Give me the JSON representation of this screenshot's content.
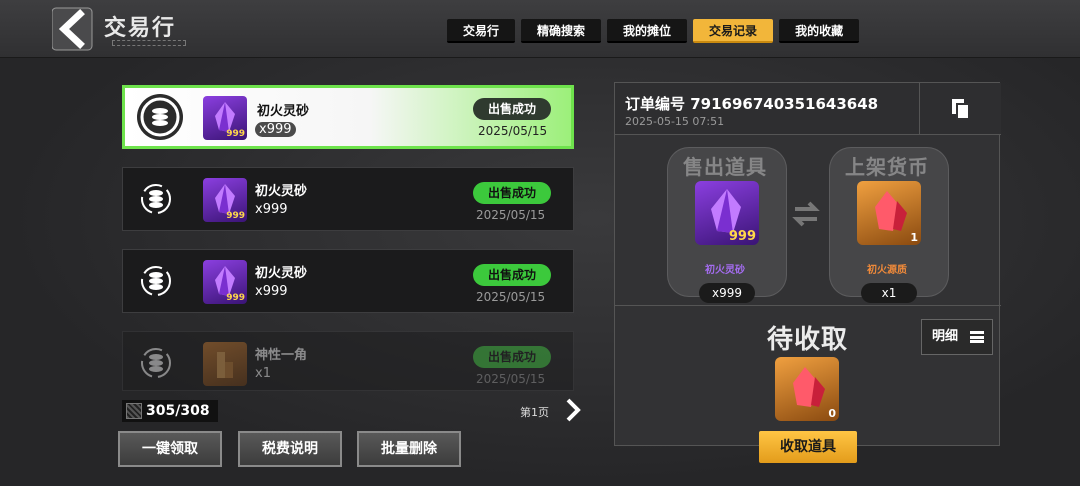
{
  "header": {
    "title": "交易行",
    "tabs": [
      {
        "label": "交易行",
        "active": false
      },
      {
        "label": "精确搜索",
        "active": false
      },
      {
        "label": "我的摊位",
        "active": false
      },
      {
        "label": "交易记录",
        "active": true
      },
      {
        "label": "我的收藏",
        "active": false
      }
    ]
  },
  "records": [
    {
      "item_name": "初火灵砂",
      "count": "x999",
      "thumb_qty": "999",
      "status": "出售成功",
      "date": "2025/05/15",
      "selected": true
    },
    {
      "item_name": "初火灵砂",
      "count": "x999",
      "thumb_qty": "999",
      "status": "出售成功",
      "date": "2025/05/15",
      "selected": false
    },
    {
      "item_name": "初火灵砂",
      "count": "x999",
      "thumb_qty": "999",
      "status": "出售成功",
      "date": "2025/05/15",
      "selected": false
    },
    {
      "item_name": "神性一角",
      "count": "x1",
      "thumb_qty": "",
      "status": "出售成功",
      "date": "2025/05/15",
      "selected": false
    }
  ],
  "footer": {
    "counter": "305/308",
    "page_label": "第1页",
    "buttons": {
      "claim_all": "一键领取",
      "tax_info": "税费说明",
      "batch_delete": "批量删除"
    }
  },
  "detail": {
    "order_label": "订单编号 791696740351643648",
    "order_time": "2025-05-15 07:51",
    "sold": {
      "title": "售出道具",
      "name": "初火灵砂",
      "corner_qty": "999",
      "qty": "x999",
      "name_color": "#a46cf0"
    },
    "listed": {
      "title": "上架货币",
      "name": "初火源质",
      "corner_qty": "1",
      "qty": "x1",
      "name_color": "#f08a3a"
    },
    "pending_title": "待收取",
    "detail_button": "明细",
    "pending_corner_qty": "0",
    "claim_button": "收取道具"
  },
  "colors": {
    "accent_green": "#6ee34c",
    "tab_active": "#f2b63a",
    "status_green": "#3cc93c"
  },
  "icons": [
    "back-chevron-icon",
    "coin-stack-icon",
    "crystal-icon",
    "copy-icon",
    "swap-icon",
    "menu-lines-icon",
    "chevron-right-icon"
  ]
}
